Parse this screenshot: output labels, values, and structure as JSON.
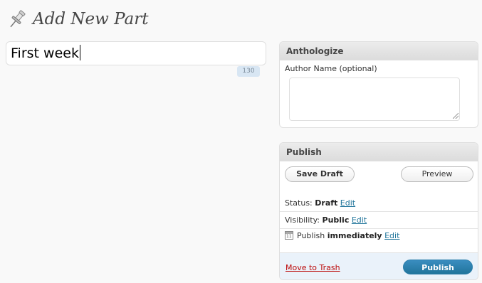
{
  "page": {
    "heading": "Add New Part"
  },
  "title_field": {
    "value": "First week",
    "counter": "130"
  },
  "anthologize_box": {
    "title": "Anthologize",
    "author_label": "Author Name (optional)",
    "author_value": ""
  },
  "publish_box": {
    "title": "Publish",
    "save_draft_label": "Save Draft",
    "preview_label": "Preview",
    "status_label": "Status:",
    "status_value": "Draft",
    "status_edit": "Edit",
    "visibility_label": "Visibility:",
    "visibility_value": "Public",
    "visibility_edit": "Edit",
    "schedule_label": "Publish",
    "schedule_value": "immediately",
    "schedule_edit": "Edit",
    "trash_label": "Move to Trash",
    "publish_label": "Publish"
  },
  "colors": {
    "link": "#21759b",
    "trash": "#bc0b0b",
    "publish_button": "#21759b"
  }
}
